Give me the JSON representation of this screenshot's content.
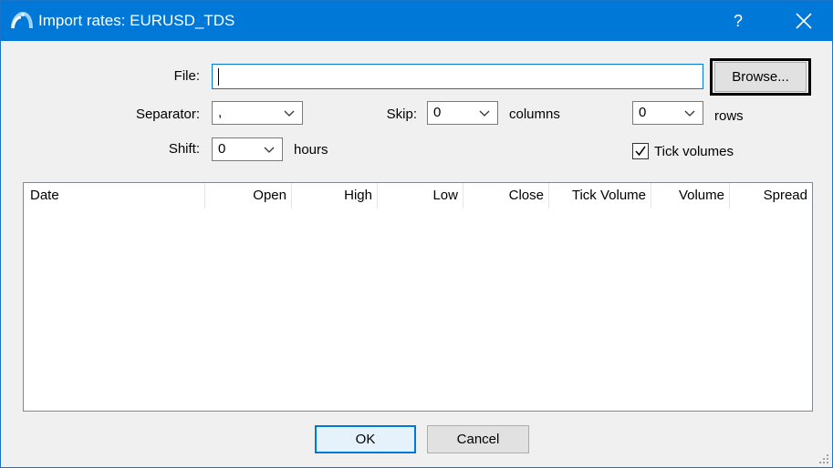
{
  "window": {
    "title": "Import rates: EURUSD_TDS",
    "help_label": "?",
    "app_icon": "metatrader-logo-icon",
    "accent_color": "#0078d7"
  },
  "file": {
    "label": "File:",
    "value": "",
    "browse_label": "Browse..."
  },
  "separator": {
    "label": "Separator:",
    "value": ","
  },
  "skip": {
    "label": "Skip:",
    "columns_value": "0",
    "columns_unit": "columns",
    "rows_value": "0",
    "rows_unit": "rows"
  },
  "shift": {
    "label": "Shift:",
    "value": "0",
    "unit": "hours"
  },
  "tick_volumes": {
    "label": "Tick volumes",
    "checked": true
  },
  "table": {
    "columns": [
      "Date",
      "Open",
      "High",
      "Low",
      "Close",
      "Tick Volume",
      "Volume",
      "Spread"
    ],
    "rows": []
  },
  "buttons": {
    "ok": "OK",
    "cancel": "Cancel"
  }
}
